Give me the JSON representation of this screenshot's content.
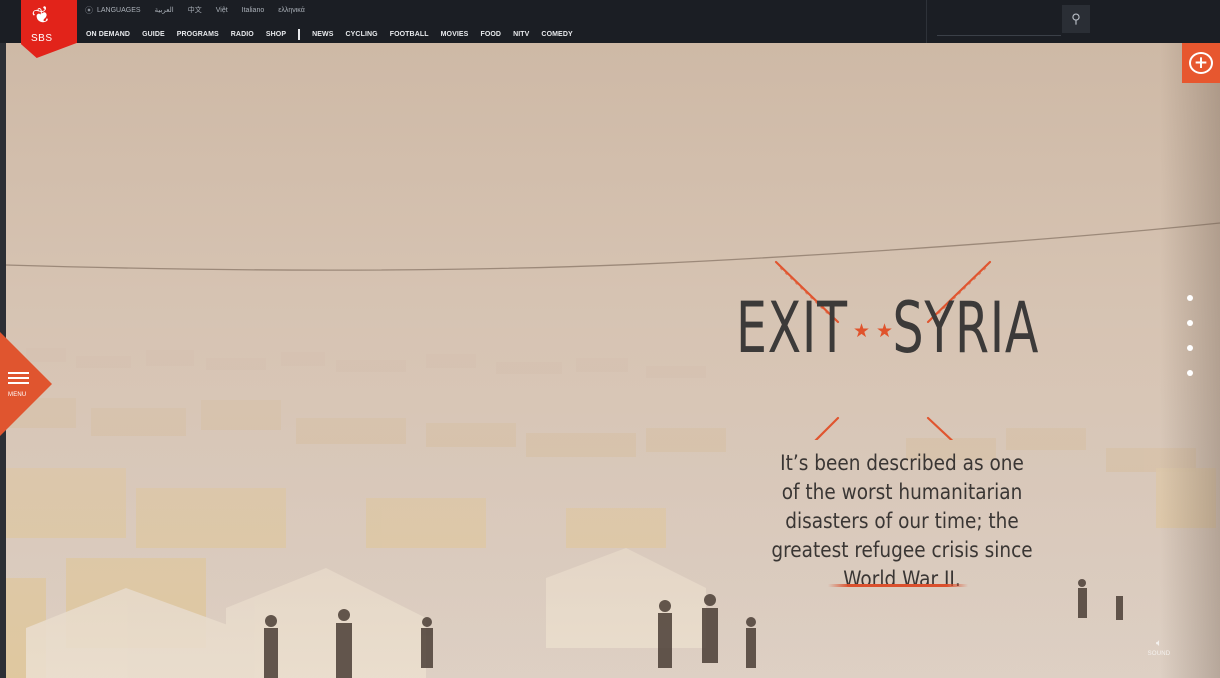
{
  "brand": {
    "logo_text": "SBS"
  },
  "languages": {
    "label": "LANGUAGES",
    "items": [
      "العربية",
      "中文",
      "Việt",
      "Italiano",
      "ελληνικά"
    ]
  },
  "nav": {
    "primary": [
      "ON DEMAND",
      "GUIDE",
      "PROGRAMS",
      "RADIO",
      "SHOP"
    ],
    "secondary": [
      "NEWS",
      "CYCLING",
      "FOOTBALL",
      "MOVIES",
      "FOOD",
      "NITV",
      "COMEDY"
    ]
  },
  "search": {
    "placeholder": "",
    "value": ""
  },
  "hero": {
    "title_left": "EXIT",
    "title_right": "SYRIA",
    "stars": "★★",
    "intro": "It’s been described as one of the worst humanitarian disasters of our time; the greatest refugee crisis since World War II."
  },
  "menu": {
    "label": "MENU"
  },
  "sound": {
    "label": "SOUND"
  },
  "icons": {
    "search": "search-icon",
    "comment": "add-comment-icon",
    "menu": "hamburger-icon",
    "sound": "speaker-icon",
    "location": "location-pin-icon"
  },
  "colors": {
    "accent": "#e0552f",
    "logo": "#e2231a",
    "topbar": "#1b1e24",
    "title": "#3c3a39"
  },
  "section_dots": 4
}
